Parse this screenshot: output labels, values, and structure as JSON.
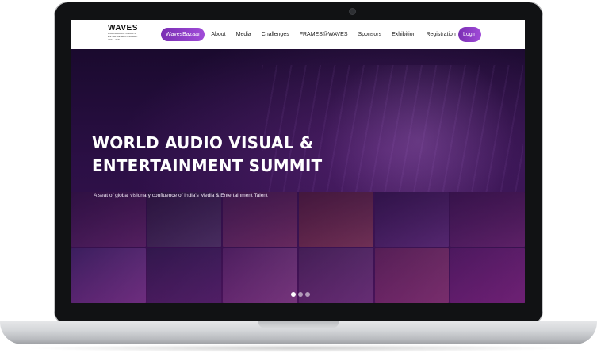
{
  "header": {
    "logo": {
      "title": "WAVES",
      "subtitle_lines": [
        "WORLD AUDIO VISUAL &",
        "ENTERTAINMENT SUMMIT"
      ],
      "footer": "INDIA - 2025"
    },
    "nav_items": [
      {
        "label": "WavesBazaar",
        "highlighted": true
      },
      {
        "label": "About"
      },
      {
        "label": "Media"
      },
      {
        "label": "Challenges"
      },
      {
        "label": "FRAMES@WAVES"
      },
      {
        "label": "Sponsors"
      },
      {
        "label": "Exhibition"
      },
      {
        "label": "Registration"
      }
    ],
    "login_label": "Login"
  },
  "hero": {
    "title_line1": "WORLD AUDIO VISUAL &",
    "title_line2": "ENTERTAINMENT SUMMIT",
    "tagline": "A seat of global visionary confluence of India's Media & Entertainment Talent",
    "carousel": {
      "total": 3,
      "active": 1
    }
  },
  "colors": {
    "accent": "#8e3cc6",
    "hero_bg": "#2b0f45",
    "nav_bg": "#ffffff"
  }
}
